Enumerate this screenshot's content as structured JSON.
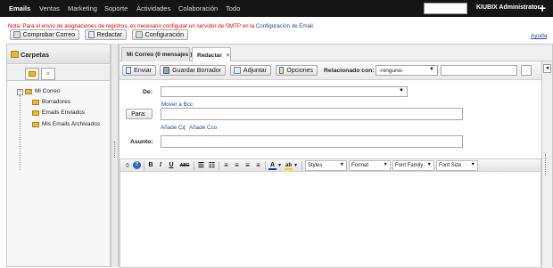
{
  "nav": {
    "items": [
      "Emails",
      "Ventas",
      "Marketing",
      "Soporte",
      "Actividades",
      "Colaboración",
      "Todo"
    ],
    "active": "Emails",
    "user_name": "KIUBIX Administrator",
    "add_symbol": "+"
  },
  "note": {
    "text": "Nota: Para el envío de asignaciones de registros, es necesario configurar un servidor de SMTP en la",
    "link": "Configuración de Email."
  },
  "toolbar": {
    "check_mail": "Comprobar Correo",
    "compose": "Redactar",
    "settings": "Configuración",
    "help": "Ayuda"
  },
  "left_panel": {
    "title": "Carpetas",
    "tree": {
      "root": "Mi Correo",
      "children": [
        "Borradores",
        "Emails Enviados",
        "Mis Emails Archivados"
      ]
    }
  },
  "tabs": [
    {
      "label": "Mi Correo (0 mensajes )"
    },
    {
      "label": "Redactar",
      "close": "✕"
    }
  ],
  "compose": {
    "send": "Enviar",
    "save_draft": "Guardar Borrador",
    "attach": "Adjuntar",
    "options": "Opciones",
    "related_label": "Relacionado con:",
    "related_value": "-ninguno-",
    "from_label": "De:",
    "move_bcc": "Mover a Bcc",
    "to_button": "Para:",
    "add_cc": "Añade Cc",
    "separator": "|",
    "add_bcc": "Añade Cco",
    "subject_label": "Asunto:"
  },
  "editor": {
    "styles": "Styles",
    "format": "Format",
    "font_family": "Font Family",
    "font_size": "Font Size"
  },
  "icons": {
    "dropdown": "▼",
    "collapse": "◂",
    "search": "⌕",
    "tree_toggle": "−",
    "bold": "B",
    "italic": "I",
    "underline": "U",
    "strike": "ABC",
    "help_icon": "?"
  },
  "colors": {
    "topbar": "#151515",
    "note": "#dd0000",
    "link": "#1a4a9a",
    "folder": "#e7b53c"
  }
}
